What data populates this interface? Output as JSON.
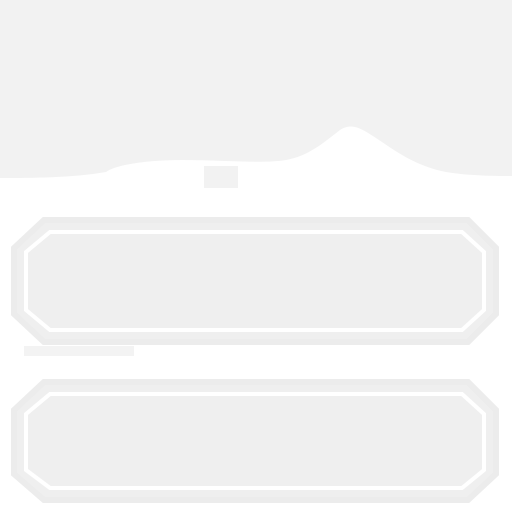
{
  "screen": {
    "background": "#ffffff",
    "header_shape_color": "#f2f2f2",
    "panel_fill": "#f0f0f0",
    "panel_border": "#ececec",
    "panel_inner_line": "#ffffff"
  },
  "panels": [
    {
      "label": ""
    },
    {
      "label": ""
    }
  ]
}
